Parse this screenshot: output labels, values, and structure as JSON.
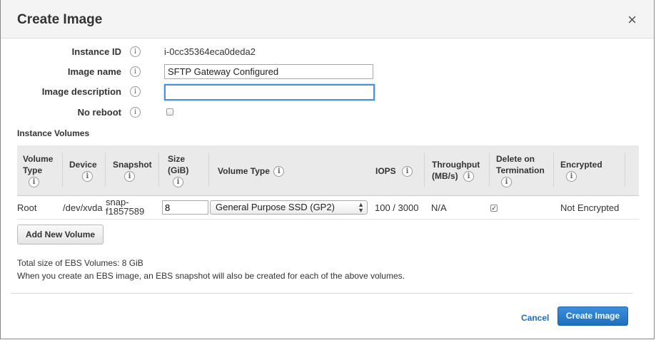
{
  "dialog": {
    "title": "Create Image",
    "close": "×"
  },
  "form": {
    "instance_id": {
      "label": "Instance ID",
      "value": "i-0cc35364eca0deda2"
    },
    "image_name": {
      "label": "Image name",
      "value": "SFTP Gateway Configured"
    },
    "image_description": {
      "label": "Image description",
      "value": ""
    },
    "no_reboot": {
      "label": "No reboot",
      "checked": false
    }
  },
  "info_icon": "i",
  "volumes": {
    "title": "Instance Volumes",
    "headers": {
      "volume_type_1": "Volume",
      "volume_type_2": "Type",
      "device": "Device",
      "snapshot": "Snapshot",
      "size_1": "Size",
      "size_2": "(GiB)",
      "volume_type": "Volume Type",
      "iops": "IOPS",
      "throughput_1": "Throughput",
      "throughput_2": "(MB/s)",
      "delete_1": "Delete on",
      "delete_2": "Termination",
      "encrypted": "Encrypted"
    },
    "rows": [
      {
        "volume_type": "Root",
        "device": "/dev/xvda",
        "snapshot_1": "snap-",
        "snapshot_2": "f1857589",
        "size": "8",
        "ebs_type": "General Purpose SSD (GP2)",
        "iops": "100 / 3000",
        "throughput": "N/A",
        "delete_on_termination": true,
        "encrypted": "Not Encrypted"
      }
    ],
    "add_button": "Add New Volume"
  },
  "notes": {
    "total_size": "Total size of EBS Volumes: 8 GiB",
    "snapshot_note": "When you create an EBS image, an EBS snapshot will also be created for each of the above volumes."
  },
  "footer": {
    "cancel": "Cancel",
    "create": "Create Image"
  },
  "colors": {
    "primary_button": "#1f6fc0",
    "link": "#1a6fbf",
    "focus_border": "#4a90d9"
  }
}
